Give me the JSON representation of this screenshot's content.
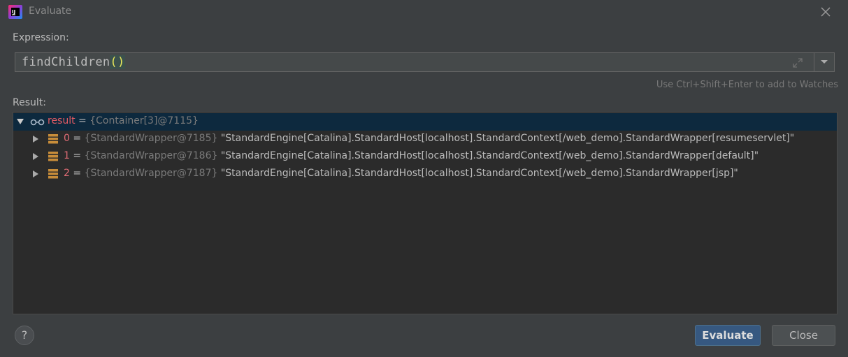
{
  "window": {
    "title": "Evaluate"
  },
  "expression": {
    "label": "Expression:",
    "text_name": "findChildren",
    "text_parens": "()"
  },
  "hint": "Use Ctrl+Shift+Enter to add to Watches",
  "result": {
    "label": "Result:",
    "root": {
      "name": "result",
      "eq": " = ",
      "ref": "{Container[3]@7115}"
    },
    "children": [
      {
        "name": "0",
        "eq": " = ",
        "ref": "{StandardWrapper@7185}",
        "value": "\"StandardEngine[Catalina].StandardHost[localhost].StandardContext[/web_demo].StandardWrapper[resumeservlet]\""
      },
      {
        "name": "1",
        "eq": " = ",
        "ref": "{StandardWrapper@7186}",
        "value": "\"StandardEngine[Catalina].StandardHost[localhost].StandardContext[/web_demo].StandardWrapper[default]\""
      },
      {
        "name": "2",
        "eq": " = ",
        "ref": "{StandardWrapper@7187}",
        "value": "\"StandardEngine[Catalina].StandardHost[localhost].StandardContext[/web_demo].StandardWrapper[jsp]\""
      }
    ]
  },
  "buttons": {
    "help": "?",
    "evaluate": "Evaluate",
    "close": "Close"
  },
  "colors": {
    "background": "#3c3f41",
    "tree_background": "#2b2b2b",
    "selection": "#0d293e",
    "primary_button": "#365880",
    "name_red": "#e06c75",
    "field_icon": "#c88d3a"
  },
  "icons": [
    "intellij-app-icon",
    "close-icon",
    "expand-icon",
    "chevron-down-icon",
    "watch-glasses-icon",
    "field-stack-icon",
    "tree-expand-arrow-icon",
    "help-icon"
  ]
}
